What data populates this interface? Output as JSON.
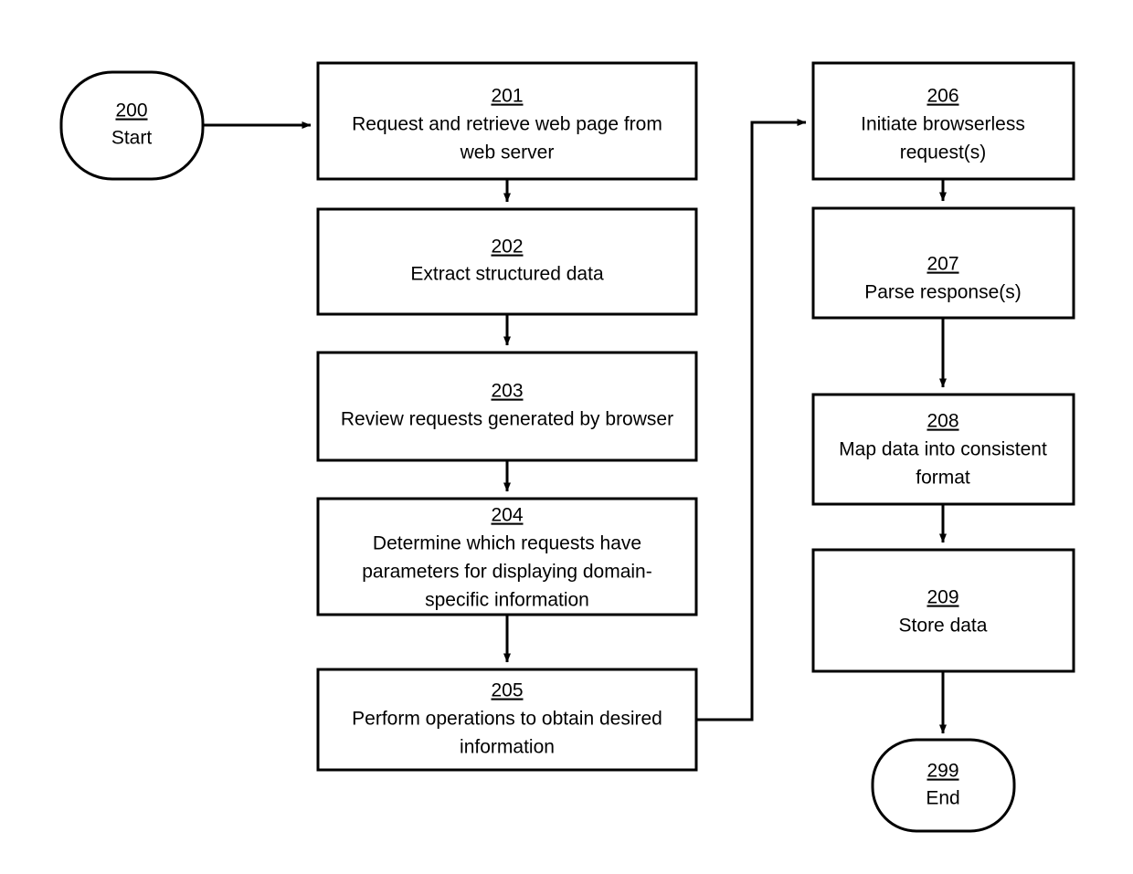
{
  "diagram": {
    "title": "Browserless data retrieval process flowchart",
    "background_color": "#ffffff",
    "stroke_color": "#000000",
    "text_color": "#000000",
    "nodes": [
      {
        "id": "start",
        "ref": "200",
        "label": "Start",
        "shape": "stadium",
        "lines": [
          "Start"
        ]
      },
      {
        "id": "n201",
        "ref": "201",
        "shape": "rect",
        "lines": [
          "Request and retrieve web page from",
          "web server"
        ]
      },
      {
        "id": "n202",
        "ref": "202",
        "shape": "rect",
        "lines": [
          "Extract structured data"
        ]
      },
      {
        "id": "n203",
        "ref": "203",
        "shape": "rect",
        "lines": [
          "Review requests generated by browser"
        ]
      },
      {
        "id": "n204",
        "ref": "204",
        "shape": "rect",
        "lines": [
          "Determine which requests have",
          "parameters for displaying domain-",
          "specific information"
        ]
      },
      {
        "id": "n205",
        "ref": "205",
        "shape": "rect",
        "lines": [
          "Perform operations to obtain desired",
          "information"
        ]
      },
      {
        "id": "n206",
        "ref": "206",
        "shape": "rect",
        "lines": [
          "Initiate browserless",
          "request(s)"
        ]
      },
      {
        "id": "n207",
        "ref": "207",
        "shape": "rect",
        "lines": [
          "Parse response(s)"
        ]
      },
      {
        "id": "n208",
        "ref": "208",
        "shape": "rect",
        "lines": [
          "Map data into consistent",
          "format"
        ]
      },
      {
        "id": "n209",
        "ref": "209",
        "shape": "rect",
        "lines": [
          "Store data"
        ]
      },
      {
        "id": "end",
        "ref": "299",
        "label": "End",
        "shape": "stadium",
        "lines": [
          "End"
        ]
      }
    ],
    "edges": [
      {
        "id": "e-start-201",
        "from": "start",
        "to": "n201",
        "style": "horizontal-arrow"
      },
      {
        "id": "e-201-202",
        "from": "n201",
        "to": "n202",
        "style": "vertical-arrow"
      },
      {
        "id": "e-202-203",
        "from": "n202",
        "to": "n203",
        "style": "vertical-arrow"
      },
      {
        "id": "e-203-204",
        "from": "n203",
        "to": "n204",
        "style": "vertical-arrow"
      },
      {
        "id": "e-204-205",
        "from": "n204",
        "to": "n205",
        "style": "vertical-arrow"
      },
      {
        "id": "e-205-206",
        "from": "n205",
        "to": "n206",
        "style": "elbow-arrow"
      },
      {
        "id": "e-206-207",
        "from": "n206",
        "to": "n207",
        "style": "vertical-arrow"
      },
      {
        "id": "e-207-208",
        "from": "n207",
        "to": "n208",
        "style": "vertical-arrow"
      },
      {
        "id": "e-208-209",
        "from": "n208",
        "to": "n209",
        "style": "vertical-arrow"
      },
      {
        "id": "e-209-end",
        "from": "n209",
        "to": "end",
        "style": "vertical-arrow"
      }
    ]
  },
  "text": {
    "start_ref": "200",
    "start_line1": "Start",
    "n201_ref": "201",
    "n201_line1": "Request and retrieve web page from",
    "n201_line2": "web server",
    "n202_ref": "202",
    "n202_line1": "Extract structured data",
    "n203_ref": "203",
    "n203_line1": "Review requests generated by browser",
    "n204_ref": "204",
    "n204_line1": "Determine which requests have",
    "n204_line2": "parameters for displaying domain-",
    "n204_line3": "specific information",
    "n205_ref": "205",
    "n205_line1": "Perform operations to obtain desired",
    "n205_line2": "information",
    "n206_ref": "206",
    "n206_line1": "Initiate browserless",
    "n206_line2": "request(s)",
    "n207_ref": "207",
    "n207_line1": "Parse response(s)",
    "n208_ref": "208",
    "n208_line1": "Map data into consistent",
    "n208_line2": "format",
    "n209_ref": "209",
    "n209_line1": "Store data",
    "end_ref": "299",
    "end_line1": "End"
  }
}
